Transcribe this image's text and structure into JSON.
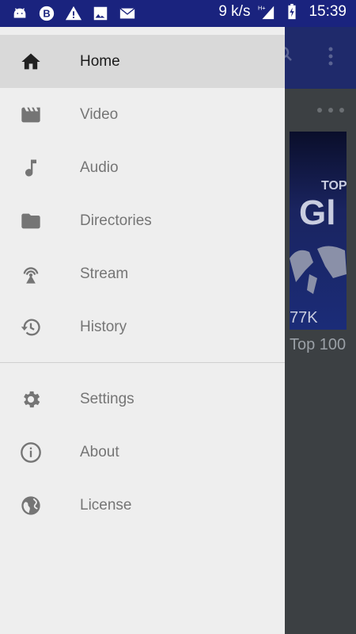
{
  "status_bar": {
    "left_icons": [
      "android-icon",
      "b-badge-icon",
      "warning-icon",
      "image-icon",
      "mail-icon"
    ],
    "speed": "9 k/s",
    "network_label": "H+",
    "time": "15:39"
  },
  "background_app": {
    "thumbnail": {
      "top_text": "TOP",
      "big_text": "Gl",
      "count": "77K",
      "title": "Top 100"
    }
  },
  "drawer": {
    "primary": [
      {
        "label": "Home",
        "icon": "home-icon",
        "active": true
      },
      {
        "label": "Video",
        "icon": "video-icon"
      },
      {
        "label": "Audio",
        "icon": "music-note-icon"
      },
      {
        "label": "Directories",
        "icon": "folder-icon"
      },
      {
        "label": "Stream",
        "icon": "broadcast-icon"
      },
      {
        "label": "History",
        "icon": "history-icon"
      }
    ],
    "secondary": [
      {
        "label": "Settings",
        "icon": "gear-icon"
      },
      {
        "label": "About",
        "icon": "info-icon"
      },
      {
        "label": "License",
        "icon": "globe-icon"
      }
    ]
  },
  "colors": {
    "status_bar": "#1a237e",
    "drawer_bg": "#eeeeee",
    "active_item_bg": "#d9d9d9",
    "icon_gray": "#757575"
  }
}
